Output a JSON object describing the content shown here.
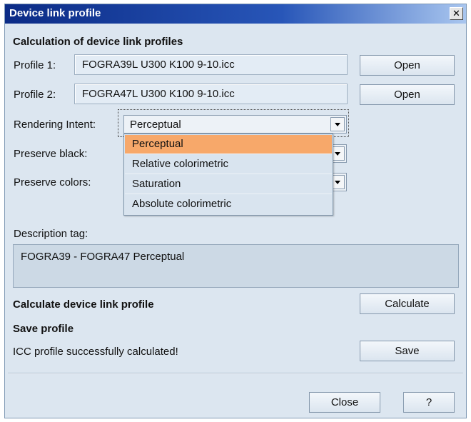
{
  "window": {
    "title": "Device link profile",
    "close_glyph": "✕"
  },
  "section": {
    "calc_heading": "Calculation of device link profiles",
    "calc_device_link": "Calculate device link profile",
    "save_heading": "Save profile",
    "status": "ICC profile successfully calculated!"
  },
  "profile1": {
    "label": "Profile 1:",
    "value": "FOGRA39L U300 K100 9-10.icc",
    "button": "Open"
  },
  "profile2": {
    "label": "Profile 2:",
    "value": "FOGRA47L U300 K100 9-10.icc",
    "button": "Open"
  },
  "rendering_intent": {
    "label": "Rendering Intent:",
    "selected": "Perceptual",
    "options": [
      "Perceptual",
      "Relative colorimetric",
      "Saturation",
      "Absolute colorimetric"
    ],
    "highlighted_index": 0
  },
  "preserve_black": {
    "label": "Preserve black:"
  },
  "preserve_colors": {
    "label": "Preserve colors:"
  },
  "description": {
    "label": "Description tag:",
    "value": "FOGRA39 - FOGRA47 Perceptual"
  },
  "buttons": {
    "calculate": "Calculate",
    "save": "Save",
    "close": "Close",
    "help": "?"
  },
  "colors": {
    "title_bar_start": "#0b2b86",
    "title_bar_end": "#a9c6ef",
    "panel_bg": "#dce6f0",
    "highlight": "#f7a86a"
  },
  "icons": {
    "close": "close-icon",
    "dropdown_arrow": "chevron-down-icon"
  }
}
